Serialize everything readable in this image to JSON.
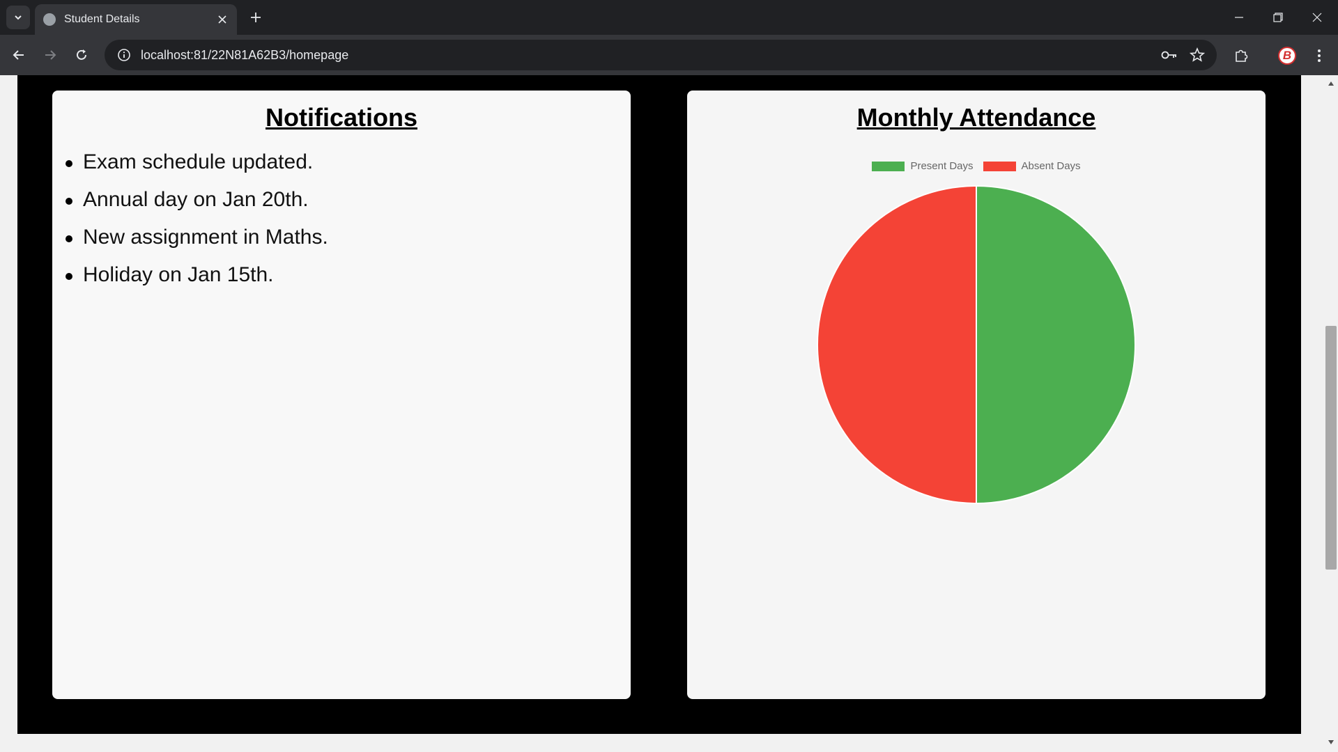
{
  "browser": {
    "tab_title": "Student Details",
    "url": "localhost:81/22N81A62B3/homepage",
    "profile_initial": "B"
  },
  "notifications": {
    "title": "Notifications",
    "items": [
      "Exam schedule updated.",
      "Annual day on Jan 20th.",
      "New assignment in Maths.",
      "Holiday on Jan 15th."
    ]
  },
  "attendance": {
    "title": "Monthly Attendance"
  },
  "chart_data": {
    "type": "pie",
    "categories": [
      "Present Days",
      "Absent Days"
    ],
    "values": [
      50,
      50
    ],
    "colors": [
      "#4caf50",
      "#f44336"
    ],
    "legend": "top"
  },
  "colors": {
    "present": "#4caf50",
    "absent": "#f44336"
  }
}
